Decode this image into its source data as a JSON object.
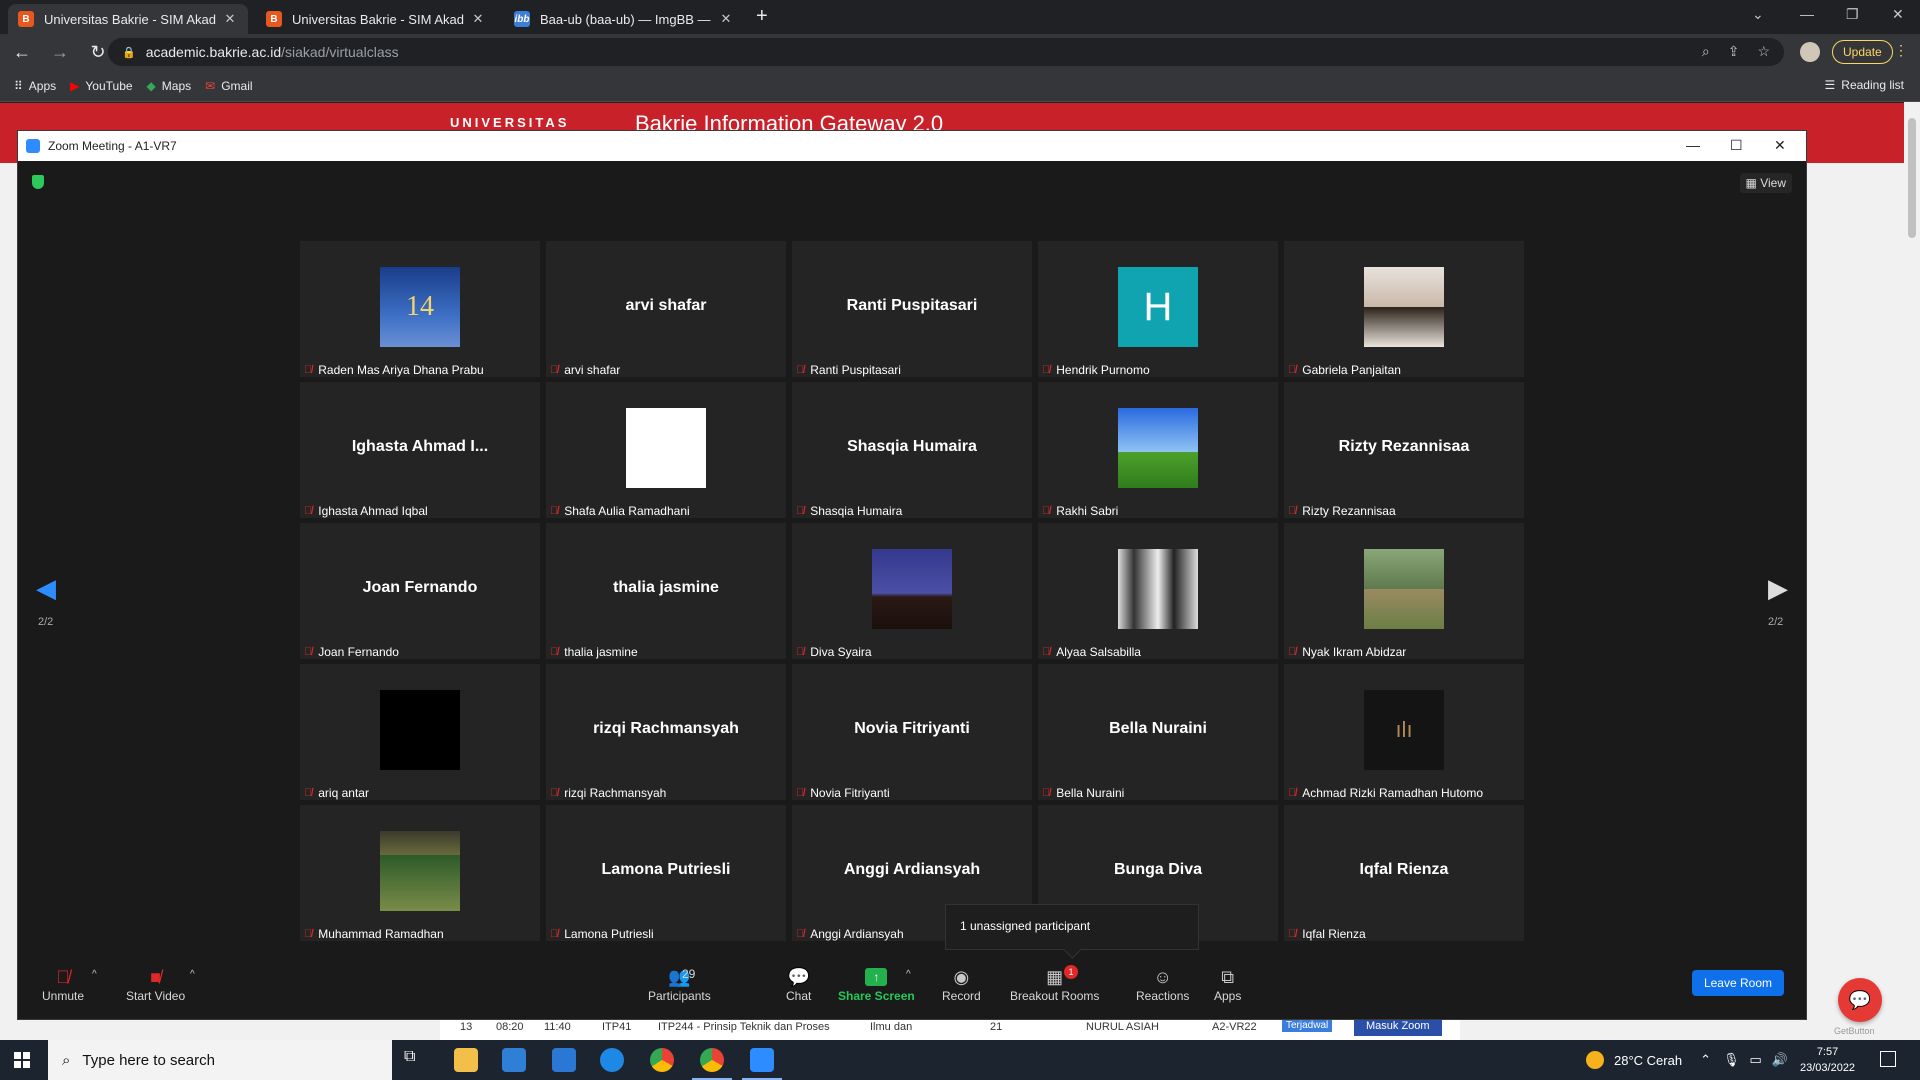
{
  "browser": {
    "tabs": [
      {
        "title": "Universitas Bakrie - SIM Akademik",
        "favicon": "B",
        "active": true
      },
      {
        "title": "Universitas Bakrie - SIM Akademik",
        "favicon": "B",
        "active": false
      },
      {
        "title": "Baa-ub (baa-ub) — ImgBB — Latest",
        "favicon": "ibb",
        "active": false
      }
    ],
    "url_host": "academic.bakrie.ac.id",
    "url_path": "/siakad/virtualclass",
    "update_label": "Update",
    "bookmarks": [
      {
        "label": "Apps",
        "icon": "apps-grid-icon",
        "color": "#e8eaed"
      },
      {
        "label": "YouTube",
        "icon": "youtube-icon",
        "color": "#ff0000"
      },
      {
        "label": "Maps",
        "icon": "maps-icon",
        "color": "#34a853"
      },
      {
        "label": "Gmail",
        "icon": "gmail-icon",
        "color": "#ea4335"
      }
    ],
    "reading_list": "Reading list"
  },
  "page": {
    "logo_text": "UNIVERSITAS",
    "gateway_title": "Bakrie Information Gateway 2.0",
    "row": {
      "no": "13",
      "start": "08:20",
      "end": "11:40",
      "code": "ITP41",
      "course": "ITP244 - Prinsip Teknik dan Proses",
      "dept": "Ilmu dan",
      "sks": "21",
      "lecturer": "NURUL ASIAH",
      "room": "A2-VR22",
      "status": "Terjadwal",
      "action": "Masuk Zoom"
    },
    "getbutton": "GetButton"
  },
  "zoom": {
    "title": "Zoom Meeting - A1-VR7",
    "view_label": "View",
    "page_indicator": "2/2",
    "tooltip": "1 unassigned participant",
    "participants": [
      {
        "display": "",
        "avatar": "av-player",
        "avatar_text": "14",
        "name": "Raden Mas Ariya Dhana Prabu"
      },
      {
        "display": "arvi shafar",
        "avatar": "",
        "name": "arvi shafar"
      },
      {
        "display": "Ranti Puspitasari",
        "avatar": "",
        "name": "Ranti Puspitasari"
      },
      {
        "display": "",
        "avatar": "av-h",
        "avatar_text": "H",
        "name": "Hendrik Purnomo"
      },
      {
        "display": "",
        "avatar": "av-girl",
        "name": "Gabriela Panjaitan"
      },
      {
        "display": "Ighasta Ahmad I...",
        "avatar": "",
        "name": "Ighasta Ahmad Iqbal"
      },
      {
        "display": "",
        "avatar": "av-white",
        "name": "Shafa Aulia Ramadhani"
      },
      {
        "display": "Shasqia Humaira",
        "avatar": "",
        "name": "Shasqia Humaira"
      },
      {
        "display": "",
        "avatar": "av-xp",
        "name": "Rakhi Sabri"
      },
      {
        "display": "Rizty Rezannisaa",
        "avatar": "",
        "name": "Rizty Rezannisaa"
      },
      {
        "display": "Joan Fernando",
        "avatar": "",
        "name": "Joan Fernando"
      },
      {
        "display": "thalia jasmine",
        "avatar": "",
        "name": "thalia jasmine"
      },
      {
        "display": "",
        "avatar": "av-night",
        "name": "Diva Syaira"
      },
      {
        "display": "",
        "avatar": "av-duo",
        "name": "Alyaa Salsabilla"
      },
      {
        "display": "",
        "avatar": "av-park",
        "name": "Nyak Ikram Abidzar"
      },
      {
        "display": "",
        "avatar": "av-black",
        "name": "ariq antar"
      },
      {
        "display": "rizqi Rachmansyah",
        "avatar": "",
        "name": "rizqi Rachmansyah"
      },
      {
        "display": "Novia Fitriyanti",
        "avatar": "",
        "name": "Novia Fitriyanti"
      },
      {
        "display": "Bella Nuraini",
        "avatar": "",
        "name": "Bella Nuraini"
      },
      {
        "display": "",
        "avatar": "av-dark",
        "avatar_text": "ılı",
        "name": "Achmad Rizki Ramadhan Hutomo"
      },
      {
        "display": "",
        "avatar": "av-sport",
        "name": "Muhammad Ramadhan"
      },
      {
        "display": "Lamona Putriesli",
        "avatar": "",
        "name": "Lamona Putriesli"
      },
      {
        "display": "Anggi Ardiansyah",
        "avatar": "",
        "name": "Anggi Ardiansyah"
      },
      {
        "display": "Bunga Diva",
        "avatar": "",
        "name": "Bunga Diva"
      },
      {
        "display": "Iqfal Rienza",
        "avatar": "",
        "name": "Iqfal Rienza"
      }
    ],
    "toolbar": {
      "unmute": "Unmute",
      "start_video": "Start Video",
      "participants": "Participants",
      "participants_count": "29",
      "chat": "Chat",
      "share_screen": "Share Screen",
      "record": "Record",
      "breakout_rooms": "Breakout Rooms",
      "breakout_badge": "1",
      "reactions": "Reactions",
      "apps": "Apps",
      "leave": "Leave Room"
    }
  },
  "taskbar": {
    "search_placeholder": "Type here to search",
    "weather": "28°C  Cerah",
    "time": "7:57",
    "date": "23/03/2022"
  }
}
